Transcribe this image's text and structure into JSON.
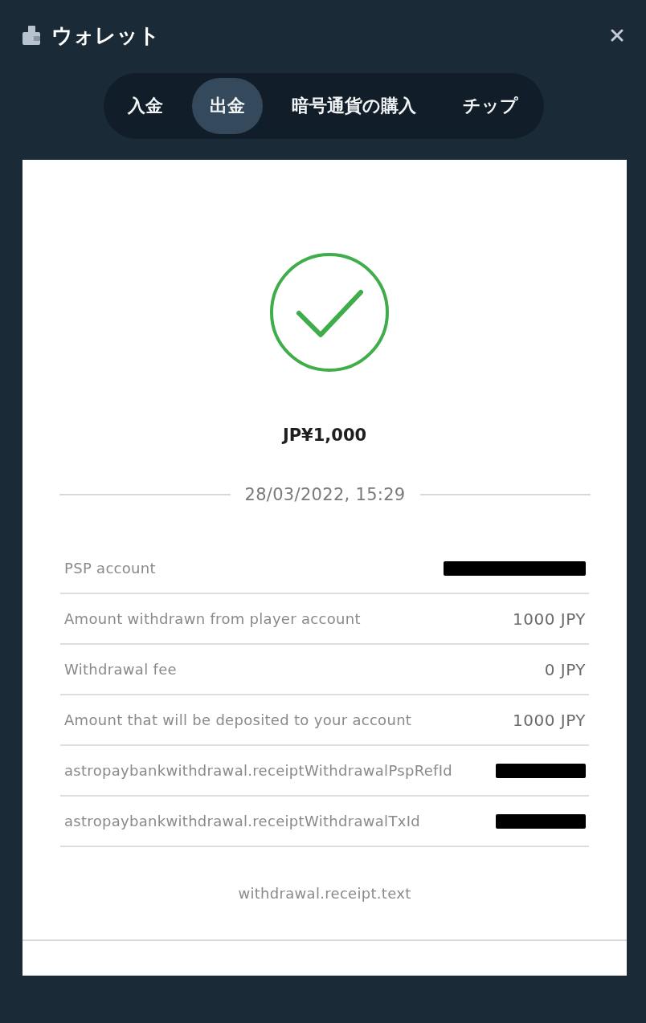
{
  "window": {
    "title": "ウォレット"
  },
  "tabs": [
    {
      "label": "入金",
      "selected": false
    },
    {
      "label": "出金",
      "selected": true
    },
    {
      "label": "暗号通貨の購入",
      "selected": false
    },
    {
      "label": "チップ",
      "selected": false
    }
  ],
  "receipt": {
    "success": true,
    "amount": "JP¥1,000",
    "datetime": "28/03/2022, 15:29",
    "rows": [
      {
        "label": "PSP account",
        "kind": "redacted"
      },
      {
        "label": "Amount withdrawn from player account",
        "kind": "text",
        "value": "1000 JPY"
      },
      {
        "label": "Withdrawal fee",
        "kind": "text",
        "value": "0 JPY"
      },
      {
        "label": "Amount that will be deposited to your account",
        "kind": "text",
        "value": "1000 JPY"
      },
      {
        "label": "astropaybankwithdrawal.receiptWithdrawalPspRefId",
        "kind": "redacted"
      },
      {
        "label": "astropaybankwithdrawal.receiptWithdrawalTxId",
        "kind": "redacted"
      }
    ],
    "footer_text": "withdrawal.receipt.text"
  }
}
